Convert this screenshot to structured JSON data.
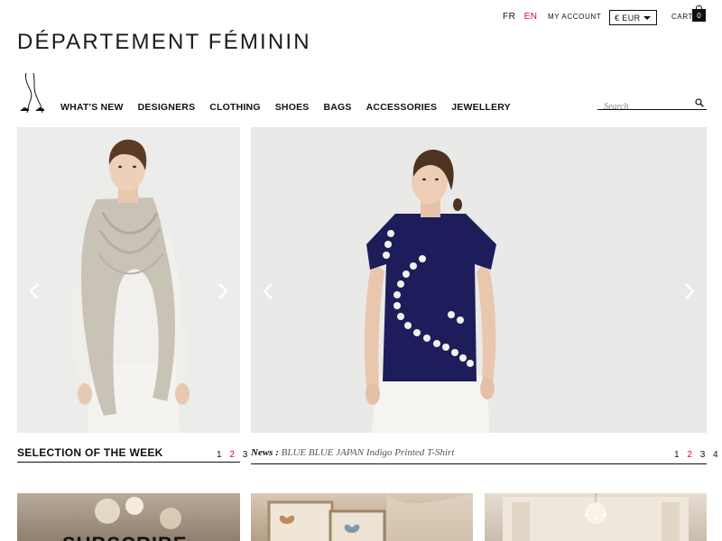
{
  "header": {
    "languages": [
      {
        "code": "FR",
        "active": false
      },
      {
        "code": "EN",
        "active": true
      }
    ],
    "account_label": "MY ACCOUNT",
    "currency": "€ EUR",
    "cart_label": "CART",
    "cart_count": "0",
    "logo": "DÉPARTEMENT FÉMININ"
  },
  "nav": {
    "items": [
      "WHAT'S NEW",
      "DESIGNERS",
      "CLOTHING",
      "SHOES",
      "BAGS",
      "ACCESSORIES",
      "JEWELLERY"
    ],
    "search_placeholder": "Search"
  },
  "selection": {
    "title": "SELECTION OF THE WEEK",
    "pages": [
      "1",
      "2",
      "3"
    ],
    "current_page": "2"
  },
  "news": {
    "label": "News :",
    "text": "BLUE BLUE JAPAN Indigo Printed T-Shirt",
    "pages": [
      "1",
      "2",
      "3",
      "4"
    ],
    "current_page": "2"
  },
  "tiles": {
    "subscribe_label": "SUBSCRIBE"
  },
  "colors": {
    "accent": "#c8102e",
    "text": "#111111",
    "shirt": "#1c1d5a"
  }
}
